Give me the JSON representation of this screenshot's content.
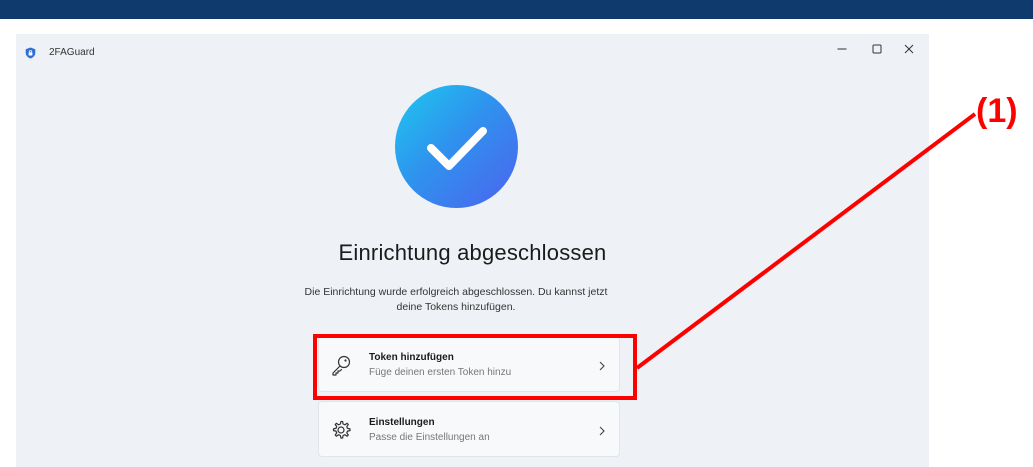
{
  "window": {
    "title": "2FAGuard",
    "controls": {
      "minimize": "minimize-icon",
      "maximize": "maximize-icon",
      "close": "close-icon"
    }
  },
  "main": {
    "success_icon": "checkmark-icon",
    "heading": "Einrichtung abgeschlossen",
    "description": "Die Einrichtung wurde erfolgreich abgeschlossen. Du kannst jetzt deine Tokens hinzufügen."
  },
  "actions": [
    {
      "title": "Token hinzufügen",
      "subtitle": "Füge deinen ersten Token hinzu",
      "icon": "key-icon"
    },
    {
      "title": "Einstellungen",
      "subtitle": "Passe die Einstellungen an",
      "icon": "gear-icon"
    }
  ],
  "annotation": {
    "label": "(1)",
    "color": "#ff0000"
  },
  "colors": {
    "top_band": "#0f3a6e",
    "window_bg": "#eef2f6",
    "success_gradient_start": "#1ec8ef",
    "success_gradient_end": "#4d62ef"
  }
}
